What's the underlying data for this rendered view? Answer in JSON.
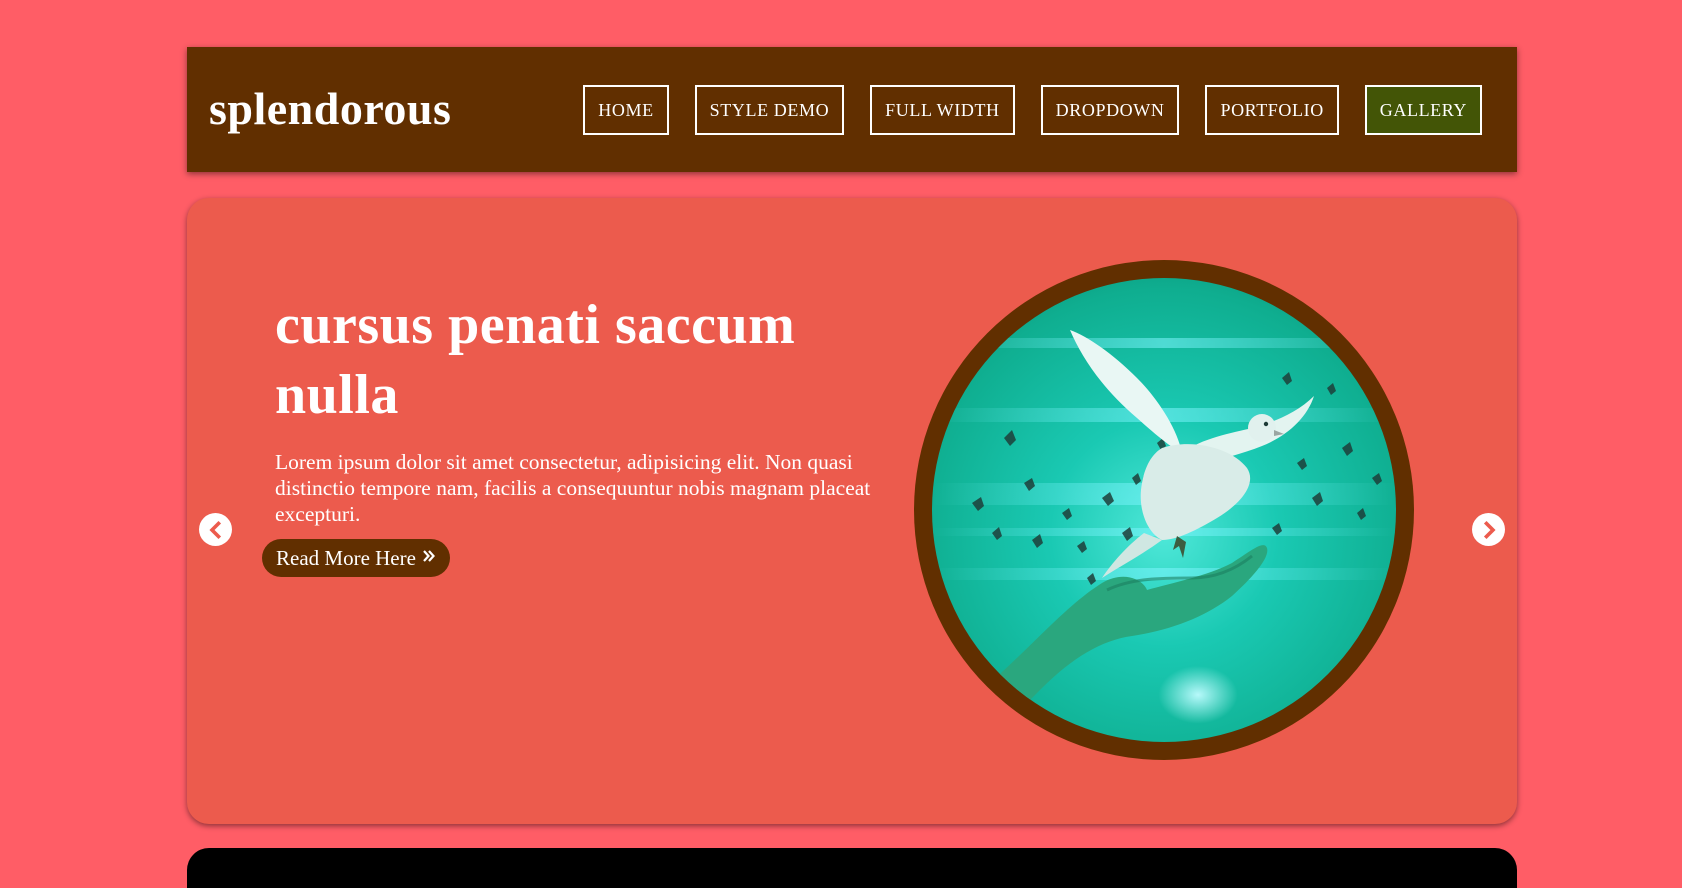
{
  "site": {
    "logo": "splendorous"
  },
  "nav": {
    "items": [
      {
        "label": "HOME"
      },
      {
        "label": "STYLE DEMO"
      },
      {
        "label": "FULL WIDTH"
      },
      {
        "label": "DROPDOWN"
      },
      {
        "label": "PORTFOLIO"
      },
      {
        "label": "GALLERY",
        "active": true
      }
    ]
  },
  "slider": {
    "title": "cursus penati saccum nulla",
    "text": "Lorem ipsum dolor sit amet consectetur, adipisicing elit. Non quasi distinctio tempore nam, facilis a consequuntur nobis magnam placeat excepturi.",
    "button_label": "Read More Here",
    "button_icon": "double-chevron-right-icon",
    "prev_icon": "chevron-left-circle-icon",
    "next_icon": "chevron-right-circle-icon",
    "image": "dove-released-from-hand"
  },
  "colors": {
    "page_background": "#ff5d66",
    "header_background": "#612f00",
    "active_nav": "#435506",
    "slider_background": "#ec5b4d",
    "image_ring": "#612f00",
    "image_teal": "#11c9a7"
  }
}
